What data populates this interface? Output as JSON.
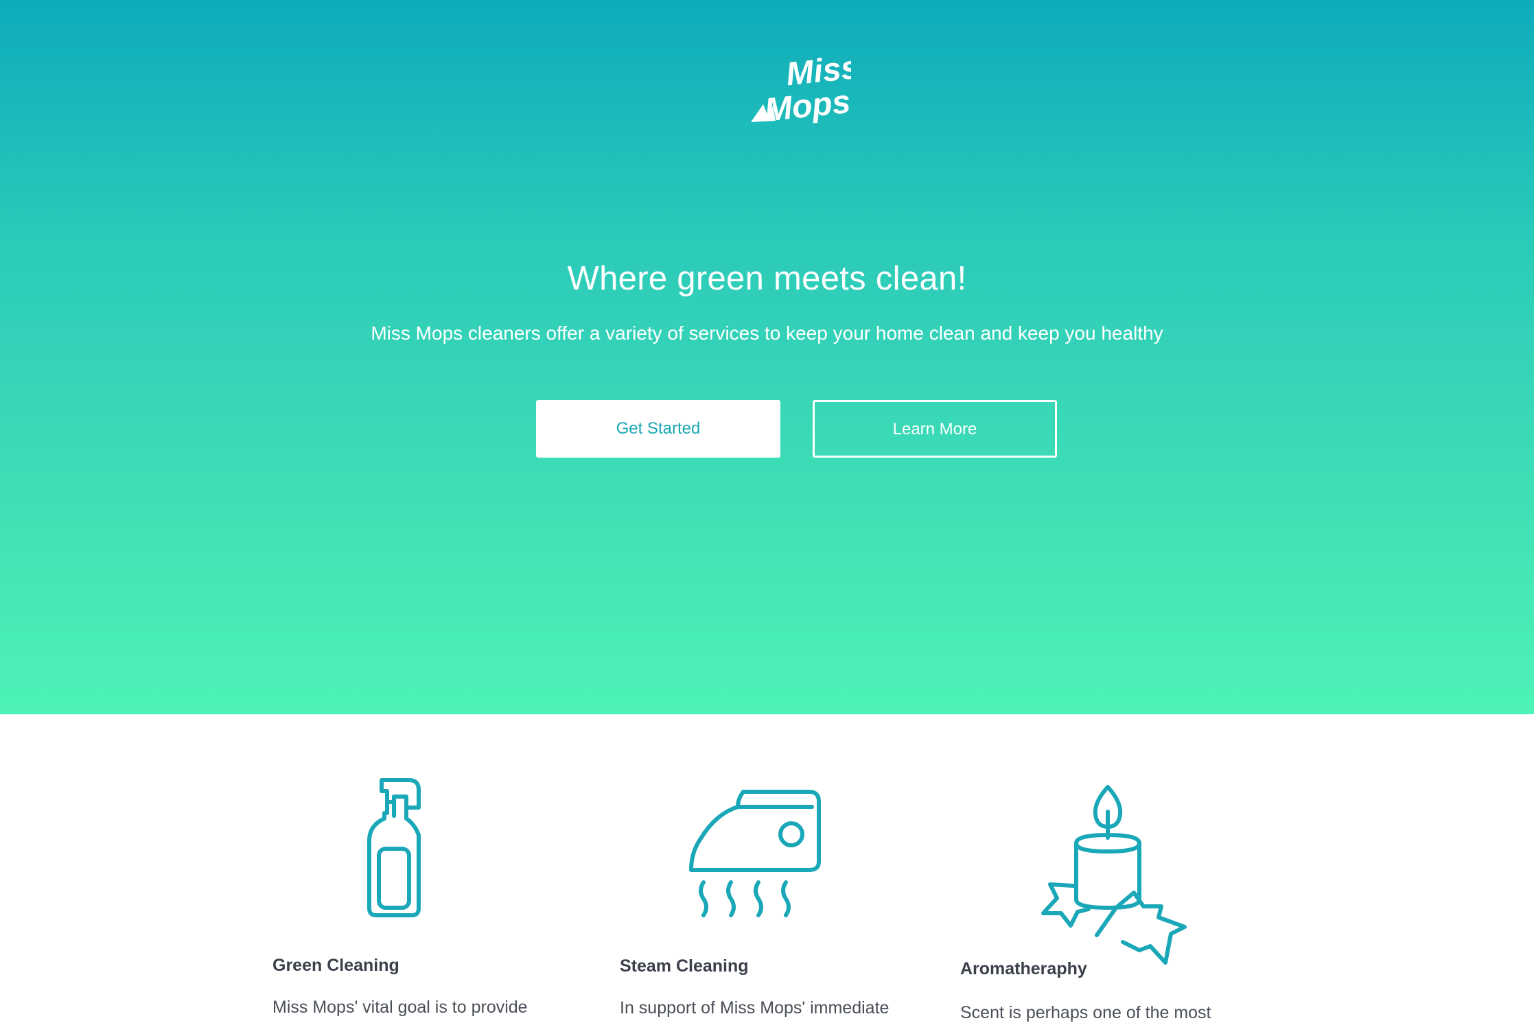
{
  "brand": {
    "logo_text_line1": "Miss",
    "logo_text_line2": "Mops"
  },
  "hero": {
    "headline": "Where green meets clean!",
    "subtitle": "Miss Mops cleaners offer a variety of services to keep your home clean and keep you healthy",
    "primary_button": "Get Started",
    "secondary_button": "Learn More"
  },
  "features": [
    {
      "icon": "spray-bottle-icon",
      "title": "Green Cleaning",
      "description": "Miss Mops' vital goal is to provide"
    },
    {
      "icon": "steam-iron-icon",
      "title": "Steam Cleaning",
      "description": "In support of Miss Mops' immediate"
    },
    {
      "icon": "candle-icon",
      "title": "Aromatheraphy",
      "description": "Scent is perhaps one of the most"
    }
  ],
  "colors": {
    "gradient_top": "#0eabbb",
    "gradient_bottom": "#4ef3b6",
    "icon_accent": "#1aa8b8",
    "button_text": "#1aa8b3"
  }
}
